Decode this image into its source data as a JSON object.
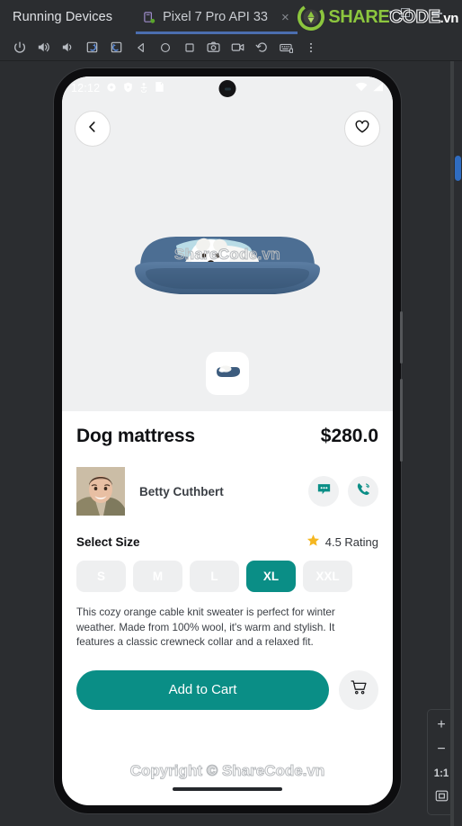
{
  "ide": {
    "tool_window_title": "Running Devices",
    "tab": {
      "label": "Pixel 7 Pro API 33",
      "close_label": "×",
      "add_label": "+",
      "device_icon": "device-running-icon"
    },
    "brand": {
      "share": "SHARE",
      "code": "CODE",
      "vn": ".vn"
    },
    "toolbar": [
      {
        "name": "power-button-icon",
        "title": "Power"
      },
      {
        "name": "volume-up-icon",
        "title": "Volume Up"
      },
      {
        "name": "volume-down-icon",
        "title": "Volume Down"
      },
      {
        "name": "rotate-left-icon",
        "title": "Rotate Left"
      },
      {
        "name": "rotate-right-icon",
        "title": "Rotate Right"
      },
      {
        "name": "back-nav-icon",
        "title": "Back"
      },
      {
        "name": "home-nav-icon",
        "title": "Home"
      },
      {
        "name": "overview-nav-icon",
        "title": "Overview"
      },
      {
        "name": "screenshot-camera-icon",
        "title": "Take Screenshot"
      },
      {
        "name": "screen-record-icon",
        "title": "Record Screen"
      },
      {
        "name": "history-rollback-icon",
        "title": "Snapshots"
      },
      {
        "name": "hardware-keyboard-icon",
        "title": "Hardware Input"
      },
      {
        "name": "more-vertical-icon",
        "title": "More"
      }
    ],
    "zoom_panel": {
      "zoom_in": "+",
      "zoom_out": "−",
      "actual_size": "1:1",
      "fit_screen_icon": "fit-to-screen-icon"
    }
  },
  "phone": {
    "statusbar": {
      "time": "12:12",
      "left_icons": [
        "gear-icon",
        "shield-play-icon",
        "debug-bug-icon",
        "sd-card-icon"
      ],
      "right_icons": [
        "wifi-icon",
        "cellular-signal-icon"
      ]
    },
    "hero": {
      "back_icon": "chevron-left-icon",
      "favorite_icon": "heart-outline-icon",
      "product_image_alt": "white-dog-on-blue-pet-bed",
      "watermark": "ShareCode.vn",
      "thumbnails": [
        {
          "name": "thumbnail-1",
          "alt": "blue-pet-bed-thumb",
          "selected": true
        }
      ]
    },
    "product": {
      "name": "Dog mattress",
      "price": "$280.0",
      "seller_name": "Betty Cuthbert",
      "seller_avatar": "seller-photo",
      "chat_icon": "chat-bubble-icon",
      "call_icon": "phone-call-icon",
      "select_size_label": "Select Size",
      "rating_text": "4.5 Rating",
      "rating_star_icon": "star-filled-icon",
      "sizes": [
        {
          "label": "S",
          "selected": false
        },
        {
          "label": "M",
          "selected": false
        },
        {
          "label": "L",
          "selected": false
        },
        {
          "label": "XL",
          "selected": true
        },
        {
          "label": "XXL",
          "selected": false
        }
      ],
      "description": "This cozy orange cable knit sweater is perfect for winter weather. Made from 100% wool, it's warm and stylish. It features a classic crewneck collar and a relaxed fit.",
      "add_to_cart_label": "Add to Cart",
      "cart_icon": "shopping-cart-icon"
    },
    "footer_watermark": "Copyright © ShareCode.vn"
  },
  "colors": {
    "accent_teal": "#0a8e86",
    "ide_background": "#2b2d30",
    "tab_underline": "#4b6eaf",
    "brand_green": "#8cc63e",
    "star_gold": "#f5b721",
    "scrollbar_blue": "#2f6cc0"
  }
}
